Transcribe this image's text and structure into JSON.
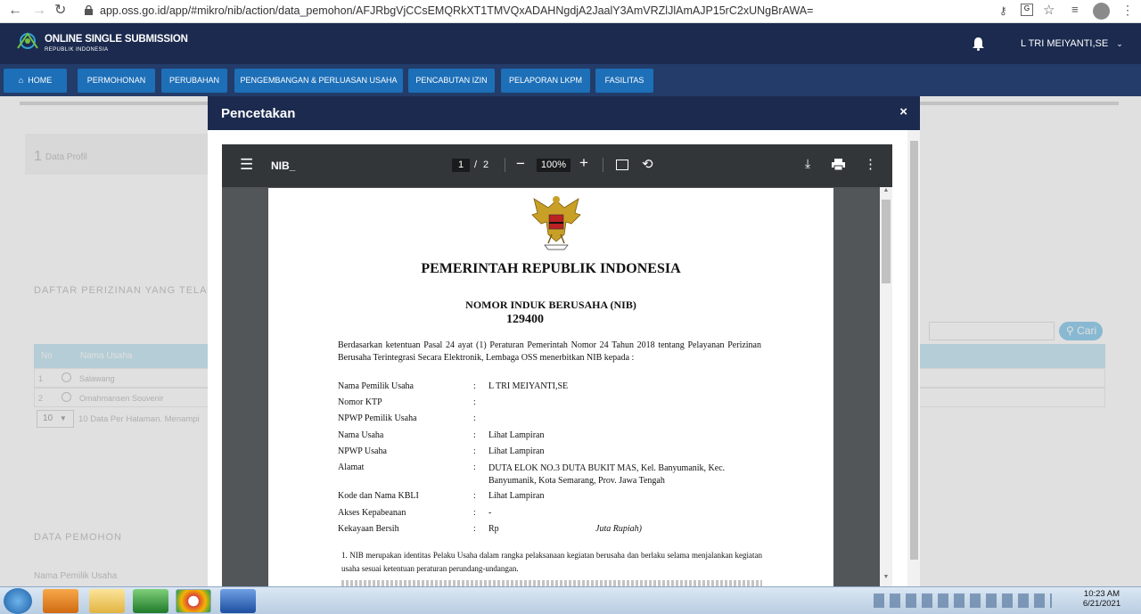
{
  "browser": {
    "url": "app.oss.go.id/app/#mikro/nib/action/data_pemohon/AFJRbgVjCCsEMQRkXT1TMVQxADAHNgdjA2JaalY3AmVRZlJlAmAJP15rC2xUNgBrAWA="
  },
  "header": {
    "logo_title": "ONLINE SINGLE SUBMISSION",
    "logo_subtitle": "REPUBLIK INDONESIA",
    "user_name": "L TRI MEIYANTI,SE"
  },
  "menu": {
    "home": "HOME",
    "items": [
      "PERMOHONAN",
      "PERUBAHAN",
      "PENGEMBANGAN & PERLUASAN USAHA",
      "PENCABUTAN IZIN",
      "PELAPORAN LKPM",
      "FASILITAS"
    ]
  },
  "background": {
    "step": "1",
    "step_label": "Data Profil",
    "section_title": "DAFTAR PERIZINAN YANG TELAH",
    "search_button": "Cari",
    "table_headers": [
      "No",
      "Nama Usaha"
    ],
    "rows": [
      {
        "no": "1",
        "nama": "Salawang"
      },
      {
        "no": "2",
        "nama": "Omahmansen Souvenir"
      }
    ],
    "page_size": "10",
    "page_info": "10 Data Per Halaman. Menampi",
    "pemohon_title": "DATA PEMOHON",
    "pemohon_label": "Nama Pemilik Usaha"
  },
  "modal": {
    "title": "Pencetakan",
    "close": "×"
  },
  "pdf": {
    "doc_title": "NIB_",
    "page_current": "1",
    "page_sep": "/",
    "page_total": "2",
    "zoom": "100%",
    "heading": "PEMERINTAH REPUBLIK INDONESIA",
    "nib_title": "NOMOR INDUK BERUSAHA (NIB)",
    "nib_number": "129400",
    "intro": "Berdasarkan ketentuan Pasal 24 ayat (1) Peraturan Pemerintah Nomor 24 Tahun 2018 tentang Pelayanan Perizinan Berusaha Terintegrasi Secara Elektronik, Lembaga OSS menerbitkan NIB kepada :",
    "fields": [
      {
        "label": "Nama Pemilik Usaha",
        "value": "L TRI MEIYANTI,SE"
      },
      {
        "label": "Nomor KTP",
        "value": ""
      },
      {
        "label": "NPWP Pemilik Usaha",
        "value": ""
      },
      {
        "label": "Nama Usaha",
        "value": "Lihat Lampiran"
      },
      {
        "label": "NPWP Usaha",
        "value": "Lihat Lampiran"
      },
      {
        "label": "Alamat",
        "value": "DUTA ELOK NO.3 DUTA BUKIT MAS, Kel. Banyumanik, Kec. Banyumanik, Kota Semarang, Prov. Jawa Tengah"
      },
      {
        "label": "Kode dan Nama KBLI",
        "value": "Lihat Lampiran"
      },
      {
        "label": "Akses Kepabeanan",
        "value": "-"
      },
      {
        "label": "Kekayaan Bersih",
        "value": "Rp"
      }
    ],
    "kekayaan_unit": "Juta Rupiah)",
    "note1": "1. NIB merupakan identitas Pelaku Usaha dalam rangka pelaksanaan kegiatan berusaha dan berlaku selama menjalankan kegiatan usaha sesuai ketentuan peraturan perundang-undangan."
  },
  "taskbar": {
    "time": "10:23 AM",
    "date": "6/21/2021"
  }
}
